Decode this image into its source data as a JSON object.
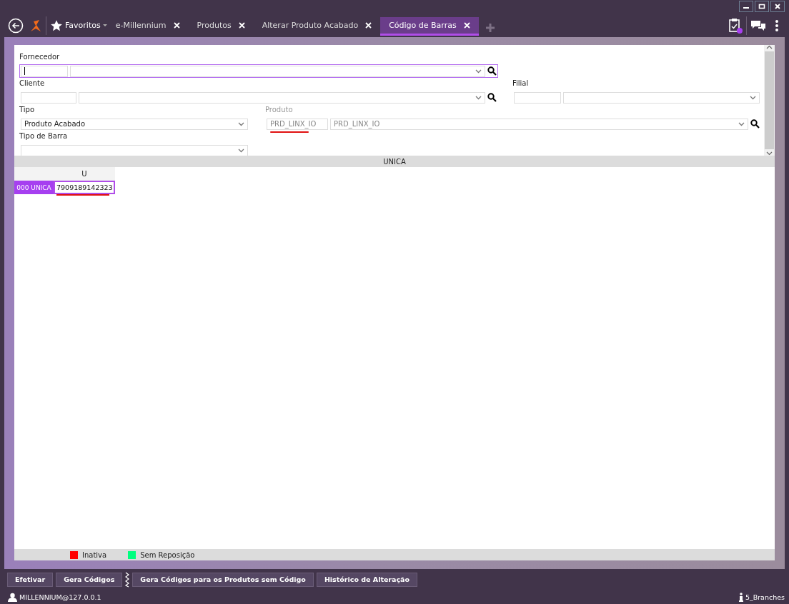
{
  "toolbar": {
    "favorites": "Favoritos"
  },
  "tabs": [
    {
      "label": "e-Millennium",
      "selected": false
    },
    {
      "label": "Produtos",
      "selected": false
    },
    {
      "label": "Alterar Produto Acabado",
      "selected": false
    },
    {
      "label": "Código de Barras",
      "selected": true
    }
  ],
  "notifications": {
    "unread": true
  },
  "form": {
    "fornecedor": {
      "label": "Fornecedor",
      "focused": true
    },
    "cliente": {
      "label": "Cliente",
      "focused": false
    },
    "filial": {
      "label": "Filial"
    },
    "tipo": {
      "label": "Tipo",
      "value": "Produto Acabado"
    },
    "produto": {
      "label": "Produto",
      "disabled": true,
      "code": "PRD_LINX_IO",
      "name": "PRD_LINX_IO",
      "underlined": true
    },
    "tipo_de_barra": {
      "label": "Tipo de Barra"
    }
  },
  "grid": {
    "group_header": "UNICA",
    "columns": [
      "U"
    ],
    "rows": [
      {
        "label": "000 UNICA",
        "cells": [
          {
            "value": "7909189142323",
            "selected": true,
            "underlined": true
          }
        ]
      }
    ]
  },
  "legend": [
    {
      "label": "Inativa",
      "color": "#ff0000"
    },
    {
      "label": "Sem Reposição",
      "color": "#00ff7f"
    }
  ],
  "actions": [
    "Efetivar",
    "Gera Códigos",
    "Gera Códigos para os Produtos sem Código",
    "Histórico de Alteração"
  ],
  "status_bar": {
    "user": "MILLENNIUM@127.0.0.1",
    "branch": "5_Branches"
  }
}
